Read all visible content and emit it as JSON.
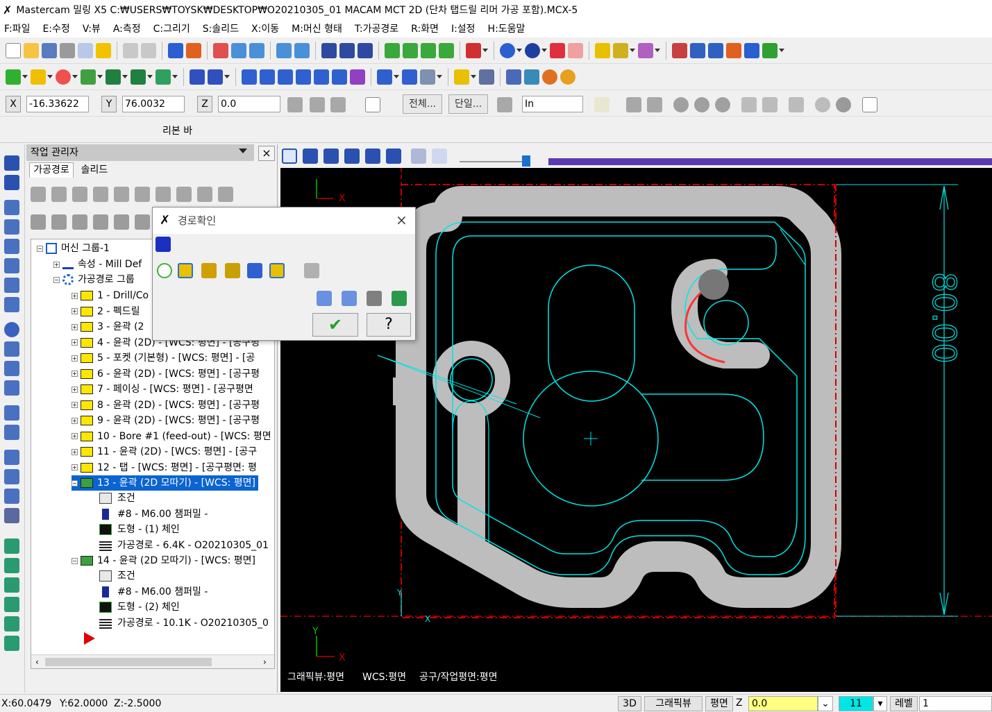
{
  "window": {
    "title": "Mastercam 밀링 X5  C:₩USERS₩TOYSK₩DESKTOP₩O20210305_01 MACAM MCT 2D (단차 탭드릴 리머 가공 포함).MCX-5"
  },
  "menu": [
    "F:파일",
    "E:수정",
    "V:뷰",
    "A:측정",
    "C:그리기",
    "S:솔리드",
    "X:이동",
    "M:머신 형태",
    "T:가공경로",
    "R:화면",
    "I:설정",
    "H:도움말"
  ],
  "coords": {
    "x_label": "X",
    "x_value": "-16.33622",
    "y_label": "Y",
    "y_value": "76.0032",
    "z_label": "Z",
    "z_value": "0.0",
    "all_btn": "전체...",
    "single_btn": "단일...",
    "unit": "In"
  },
  "ribbon": {
    "label": "리본 바"
  },
  "panel": {
    "title": "작업 관리자",
    "tabs": [
      "가공경로",
      "솔리드"
    ],
    "close": "×"
  },
  "tree": {
    "root": "머신 그룹-1",
    "props": "속성 - Mill Def",
    "group": "가공경로 그룹",
    "ops": [
      "1 - Drill/Co",
      "2 - 펙드릴",
      "3 - 윤곽 (2",
      "4 - 윤곽 (2D) - [WCS: 평면] - [공구평",
      "5 - 포켓 (기본형) - [WCS: 평면] - [공",
      "6 - 윤곽 (2D) - [WCS: 평면] - [공구평",
      "7 - 페이싱 - [WCS: 평면] - [공구평면",
      "8 - 윤곽 (2D) - [WCS: 평면] - [공구평",
      "9 - 윤곽 (2D) - [WCS: 평면] - [공구평",
      "10 - Bore #1 (feed-out) - [WCS: 평면",
      "11 - 윤곽 (2D) - [WCS: 평면] - [공구",
      "12 - 탭 - [WCS: 평면] - [공구평면: 평"
    ],
    "op13": "13 - 윤곽 (2D 모따기) - [WCS: 평면]",
    "op13_children": [
      "조건",
      "#8 - M6.00 챔퍼밀 -",
      "도형 - (1) 체인",
      "가공경로 - 6.4K - O20210305_01"
    ],
    "op14": "14 - 윤곽 (2D 모따기) - [WCS: 평면]",
    "op14_children": [
      "조건",
      "#8 - M6.00 챔퍼밀 -",
      "도형 - (2) 체인",
      "가공경로 - 10.1K - O20210305_0"
    ]
  },
  "dialog": {
    "title": "경로확인",
    "help": "?"
  },
  "viewport": {
    "dimension": "80.00",
    "axis_x": "X",
    "axis_y": "Y",
    "info": [
      "그래픽뷰:평면",
      "WCS:평면",
      "공구/작업평면:평면"
    ]
  },
  "status": {
    "x": "X:60.0479",
    "y": "Y:62.0000",
    "z": "Z:-2.5000",
    "btn_3d": "3D",
    "btn_gview": "그래픽뷰",
    "btn_plane": "평면",
    "z_label": "Z",
    "z_value": "0.0",
    "level_num": "11",
    "level_label": "레벨",
    "level_value": "1"
  },
  "colors": {
    "toolpath": "#00e5e5",
    "stock": "#bfbfbf",
    "boundary": "#cc0000",
    "selected": "#0a64d2"
  }
}
